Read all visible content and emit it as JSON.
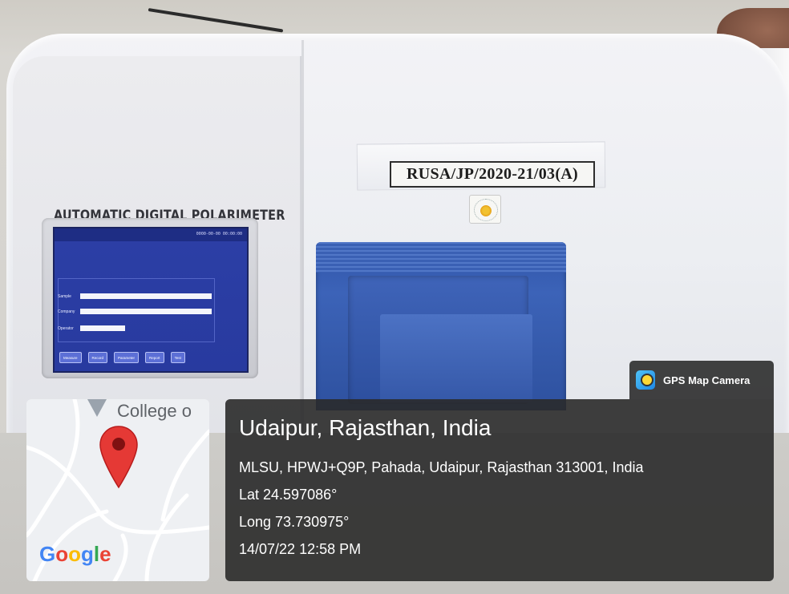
{
  "instrument": {
    "label": "AUTOMATIC DIGITAL POLARIMETER",
    "asset_tag": "RUSA/JP/2020-21/03(A)",
    "screen": {
      "time": "0000-00-00 00:00:00",
      "fields": [
        {
          "label": "Sample"
        },
        {
          "label": "Company"
        },
        {
          "label": "Operator"
        }
      ],
      "buttons": [
        "Measure",
        "Record",
        "Parameter",
        "Report",
        "Test"
      ]
    }
  },
  "gps_overlay": {
    "app_name": "GPS Map Camera",
    "city": "Udaipur, Rajasthan, India",
    "address": "MLSU, HPWJ+Q9P, Pahada, Udaipur, Rajasthan 313001, India",
    "lat": "Lat 24.597086°",
    "long": "Long 73.730975°",
    "datetime": "14/07/22 12:58 PM"
  },
  "map": {
    "label": "College o",
    "brand": "Google"
  },
  "colors": {
    "screen_blue": "#2c3fa6",
    "compartment_blue": "#3c63b8",
    "overlay_dark": "#2a2a2a",
    "pin_red": "#e53935"
  }
}
